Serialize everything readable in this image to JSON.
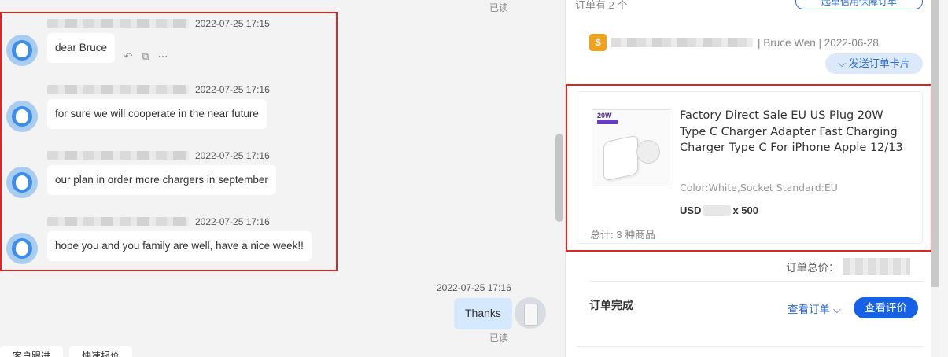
{
  "chat": {
    "read_top": "已读",
    "messages": [
      {
        "time": "2022-07-25 17:15",
        "text": "dear Bruce"
      },
      {
        "time": "2022-07-25 17:16",
        "text": "for sure we will cooperate in the near future"
      },
      {
        "time": "2022-07-25 17:16",
        "text": "our plan in order more chargers in september"
      },
      {
        "time": "2022-07-25 17:16",
        "text": "hope you and you family are well, have a nice week!!"
      }
    ],
    "tools": [
      "↶",
      "⧉",
      "⋯"
    ],
    "outgoing": {
      "time": "2022-07-25 17:16",
      "text": "Thanks",
      "status": "已读"
    },
    "bottom_tabs": [
      "客户跟进",
      "快速报价"
    ]
  },
  "order": {
    "title": "订单有 2 个",
    "guarantee_button": "起草信用保障订单",
    "header_text": "| Bruce Wen | 2022-06-28",
    "coin_icon_glyph": "$",
    "send_card": "发送订单卡片",
    "product": {
      "badge": "20W",
      "title": "Factory Direct Sale EU US Plug 20W Type C Charger Adapter Fast Charging Charger Type C For iPhone Apple 12/13",
      "attributes": "Color:White,Socket Standard:EU",
      "price_prefix": "USD",
      "quantity": "x 500",
      "total": "总计: 3 种商品"
    },
    "order_total_label": "订单总价：",
    "status": "订单完成",
    "view_order": "查看订单",
    "view_review": "查看评价"
  },
  "colors": {
    "accent": "#1661e6",
    "highlight_border": "#d62828",
    "incoming_bubble": "#ffffff",
    "outgoing_bubble": "#d6e8fb"
  }
}
